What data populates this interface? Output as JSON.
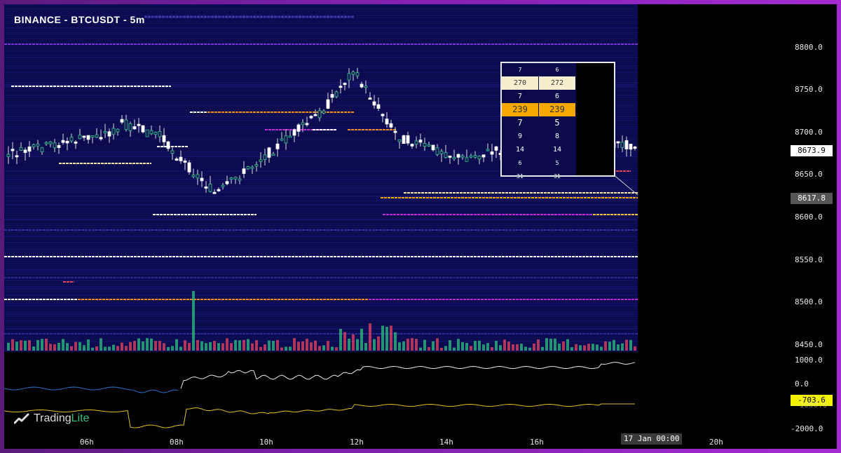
{
  "header": {
    "title": "BINANCE - BTCUSDT - 5m"
  },
  "logo": {
    "brand_main": "Trading",
    "brand_accent": "Lite"
  },
  "price_axis": {
    "ticks": [
      "8800.0",
      "8750.0",
      "8700.0",
      "8650.0",
      "8600.0",
      "8550.0",
      "8500.0",
      "8450.0"
    ],
    "current_price": "8673.9",
    "marker_price": "8617.8"
  },
  "osc_axis": {
    "ticks": [
      "1000.0",
      "0.0",
      "-1000.0",
      "-2000.0"
    ],
    "current_value": "-703.6"
  },
  "time_axis": {
    "ticks": [
      "06h",
      "08h",
      "10h",
      "12h",
      "14h",
      "16h",
      "20h"
    ],
    "cursor_label": "17 Jan 00:00"
  },
  "orderbook": {
    "rows": [
      {
        "left": "7",
        "right": "6",
        "style": "tiny"
      },
      {
        "left": "270",
        "right": "272",
        "style": "hl-light"
      },
      {
        "left": "7",
        "right": "6",
        "style": "normal"
      },
      {
        "left": "239",
        "right": "239",
        "style": "hl-orange"
      },
      {
        "left": "7",
        "right": "5",
        "style": "big"
      },
      {
        "left": "9",
        "right": "8",
        "style": "normal"
      },
      {
        "left": "14",
        "right": "14",
        "style": "normal"
      },
      {
        "left": "6",
        "right": "5",
        "style": "tiny"
      },
      {
        "left": "31",
        "right": "31",
        "style": "tiny"
      }
    ]
  },
  "colors": {
    "up": "#2ec27e",
    "down": "#e8445e",
    "heat_bg": "#0a0a4a",
    "osc_white": "#e8e8e8",
    "osc_yellow": "#e0c020",
    "osc_blue": "#2a6fd0"
  }
}
